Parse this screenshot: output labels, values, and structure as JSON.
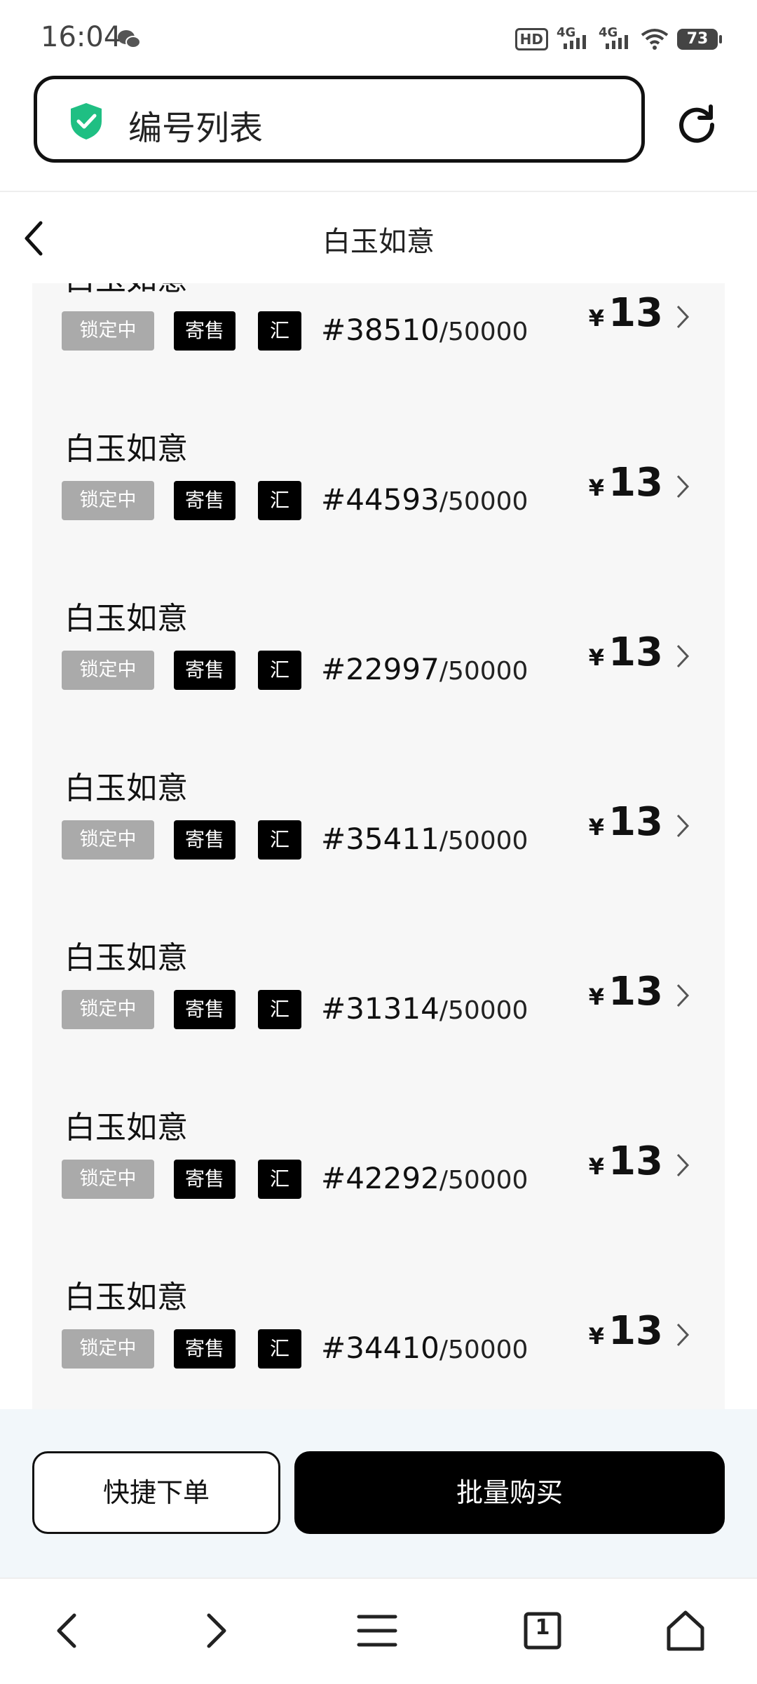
{
  "status_bar": {
    "time": "16:04",
    "hd": "HD",
    "net1": "4G",
    "net2": "4G",
    "battery": "73"
  },
  "url_bar": {
    "title": "编号列表"
  },
  "header": {
    "title": "白玉如意"
  },
  "list": {
    "items": [
      {
        "name": "白玉如意",
        "tag_locked": "锁定中",
        "tag_consign": "寄售",
        "tag_hui": "汇",
        "serial": "#38510",
        "total": "/50000",
        "currency": "¥",
        "price": "13"
      },
      {
        "name": "白玉如意",
        "tag_locked": "锁定中",
        "tag_consign": "寄售",
        "tag_hui": "汇",
        "serial": "#44593",
        "total": "/50000",
        "currency": "¥",
        "price": "13"
      },
      {
        "name": "白玉如意",
        "tag_locked": "锁定中",
        "tag_consign": "寄售",
        "tag_hui": "汇",
        "serial": "#22997",
        "total": "/50000",
        "currency": "¥",
        "price": "13"
      },
      {
        "name": "白玉如意",
        "tag_locked": "锁定中",
        "tag_consign": "寄售",
        "tag_hui": "汇",
        "serial": "#35411",
        "total": "/50000",
        "currency": "¥",
        "price": "13"
      },
      {
        "name": "白玉如意",
        "tag_locked": "锁定中",
        "tag_consign": "寄售",
        "tag_hui": "汇",
        "serial": "#31314",
        "total": "/50000",
        "currency": "¥",
        "price": "13"
      },
      {
        "name": "白玉如意",
        "tag_locked": "锁定中",
        "tag_consign": "寄售",
        "tag_hui": "汇",
        "serial": "#42292",
        "total": "/50000",
        "currency": "¥",
        "price": "13"
      },
      {
        "name": "白玉如意",
        "tag_locked": "锁定中",
        "tag_consign": "寄售",
        "tag_hui": "汇",
        "serial": "#34410",
        "total": "/50000",
        "currency": "¥",
        "price": "13"
      }
    ]
  },
  "actions": {
    "quick_order": "快捷下单",
    "batch_buy": "批量购买"
  },
  "browser_toolbar": {
    "tab_count": "1"
  },
  "colors": {
    "accent_green": "#1fbf83",
    "locked_gray": "#aaaaaa",
    "black": "#000000",
    "panel_bg": "#f7f7f7"
  }
}
